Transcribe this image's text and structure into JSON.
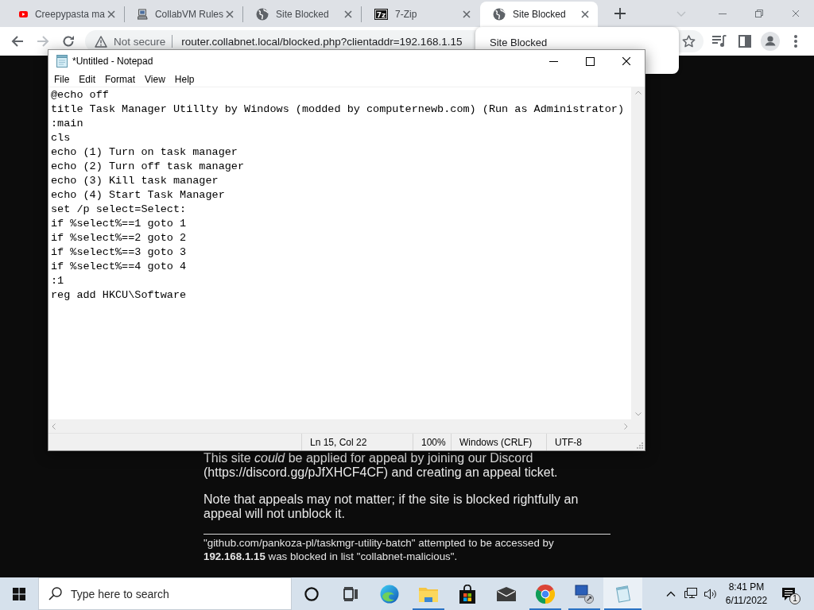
{
  "browser": {
    "tabs": [
      {
        "title": "Creepypasta ma",
        "kind": "video",
        "selected": false
      },
      {
        "title": "CollabVM Rules",
        "kind": "vm",
        "selected": false
      },
      {
        "title": "Site Blocked",
        "kind": "web",
        "selected": false
      },
      {
        "title": "7-Zip",
        "kind": "archive",
        "icon_label": "7z",
        "selected": false
      },
      {
        "title": "Site Blocked",
        "kind": "web",
        "selected": true
      }
    ],
    "nav_buttons": [
      {
        "kind": "back",
        "disabled": false
      },
      {
        "kind": "forward",
        "disabled": true
      },
      {
        "kind": "reload",
        "disabled": false
      }
    ],
    "address_bar": {
      "security": "Not secure",
      "url": "router.collabnet.local/blocked.php?clientaddr=192.168.1.15"
    },
    "hover_card": {
      "title": "Site Blocked"
    },
    "page": {
      "paragraphs": [
        "This site *could* be applied for appeal by joining our Discord (https://discord.gg/pJfXHCF4CF) and creating an appeal ticket.",
        "Note that appeals may not matter; if the site is blocked rightfully an appeal will not unblock it."
      ],
      "footer": "\"github.com/pankoza-pl/taskmgr-utility-batch\" attempted to be accessed by **192.168.1.15** was blocked in list \"collabnet-malicious\"."
    }
  },
  "notepad": {
    "title": "*Untitled - Notepad",
    "menu": [
      "File",
      "Edit",
      "Format",
      "View",
      "Help"
    ],
    "lines": [
      "@echo off",
      "title Task Manager Utillty by Windows (modded by computernewb.com) (Run as Administrator)",
      ":main",
      "cls",
      "echo (1) Turn on task manager",
      "echo (2) Turn off task manager",
      "echo (3) Kill task manager",
      "echo (4) Start Task Manager",
      "set /p select=Select:",
      "if %select%==1 goto 1",
      "if %select%==2 goto 2",
      "if %select%==3 goto 3",
      "if %select%==4 goto 4",
      ":1",
      "reg add HKCU\\Software"
    ],
    "status_bar": [
      "Ln 15, Col 22",
      "100%",
      "Windows (CRLF)",
      "UTF-8"
    ]
  },
  "taskbar": {
    "search": {
      "placeholder": "Type here to search"
    },
    "apps": [
      {
        "kind": "circle",
        "running": false,
        "active": false
      },
      {
        "kind": "task-view",
        "running": false,
        "active": false
      },
      {
        "kind": "swirl",
        "running": false,
        "active": false
      },
      {
        "kind": "folder",
        "running": true,
        "active": false
      },
      {
        "kind": "store",
        "running": false,
        "active": false
      },
      {
        "kind": "mail",
        "running": false,
        "active": false
      },
      {
        "kind": "tricolor",
        "running": true,
        "active": false
      },
      {
        "kind": "computer",
        "running": true,
        "active": false
      },
      {
        "kind": "notepad",
        "running": true,
        "active": true
      }
    ],
    "clock": {
      "time": "8:41 PM",
      "date": "6/11/2022"
    },
    "notifications": {
      "count": "1"
    }
  }
}
